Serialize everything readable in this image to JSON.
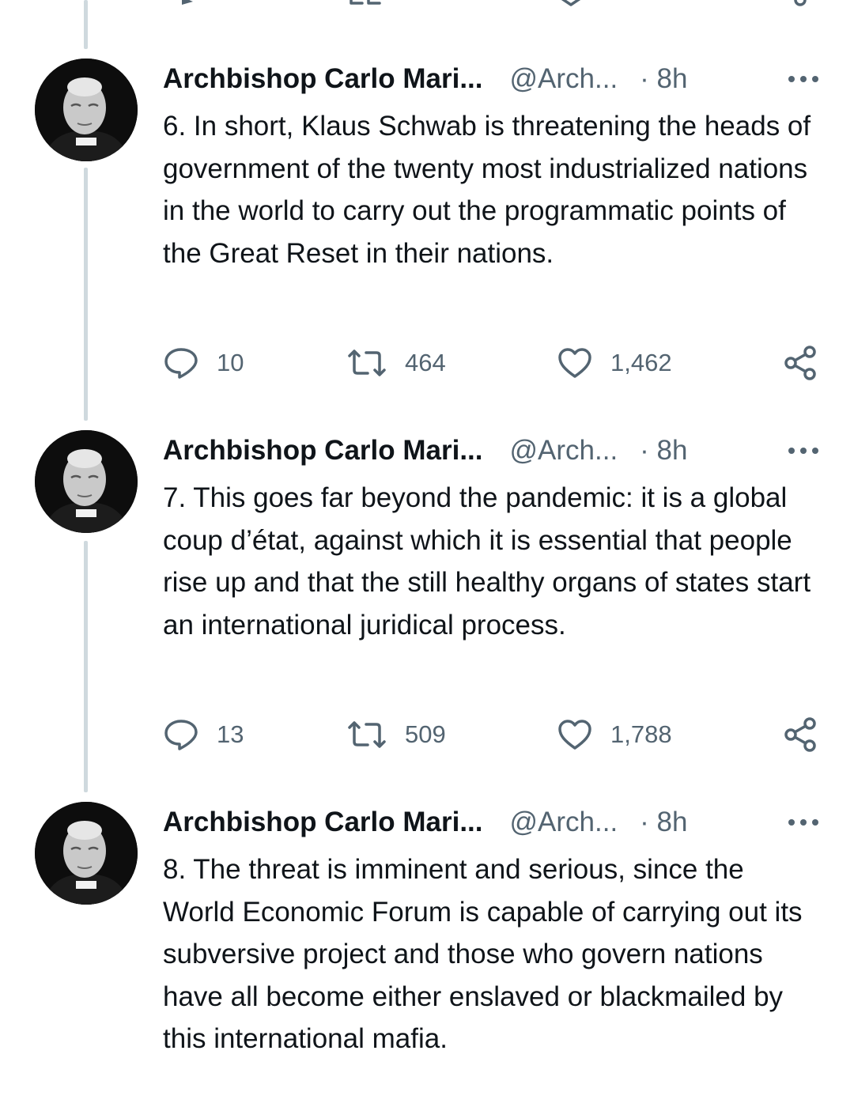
{
  "tweets": [
    {
      "author": {
        "display_name": "Archbishop Carlo Mari...",
        "handle": "@Arch...",
        "time": "· 8h"
      },
      "text": "6. In short, Klaus Schwab is threatening the heads of government of the twenty most industrialized nations in the world to carry out the programmatic points of the Great Reset in their nations.",
      "replies": "10",
      "retweets": "464",
      "likes": "1,462"
    },
    {
      "author": {
        "display_name": "Archbishop Carlo Mari...",
        "handle": "@Arch...",
        "time": "· 8h"
      },
      "text": "7. This goes far beyond the pandemic: it is a global coup d’état, against which it is essential that people rise up and that the still healthy organs of states start an international juridical process.",
      "replies": "13",
      "retweets": "509",
      "likes": "1,788"
    },
    {
      "author": {
        "display_name": "Archbishop Carlo Mari...",
        "handle": "@Arch...",
        "time": "· 8h"
      },
      "text": "8. The threat is imminent and serious, since the World Economic Forum is capable of carrying out its subversive project and those who govern nations have all become either enslaved or blackmailed by this international mafia."
    }
  ],
  "colors": {
    "text_primary": "#0f1419",
    "text_secondary": "#536471",
    "thread_line": "#cfd9de",
    "background": "#ffffff"
  },
  "icons": {
    "reply": "reply-icon",
    "retweet": "retweet-icon",
    "like": "heart-icon",
    "share": "share-icon",
    "more": "more-icon"
  }
}
